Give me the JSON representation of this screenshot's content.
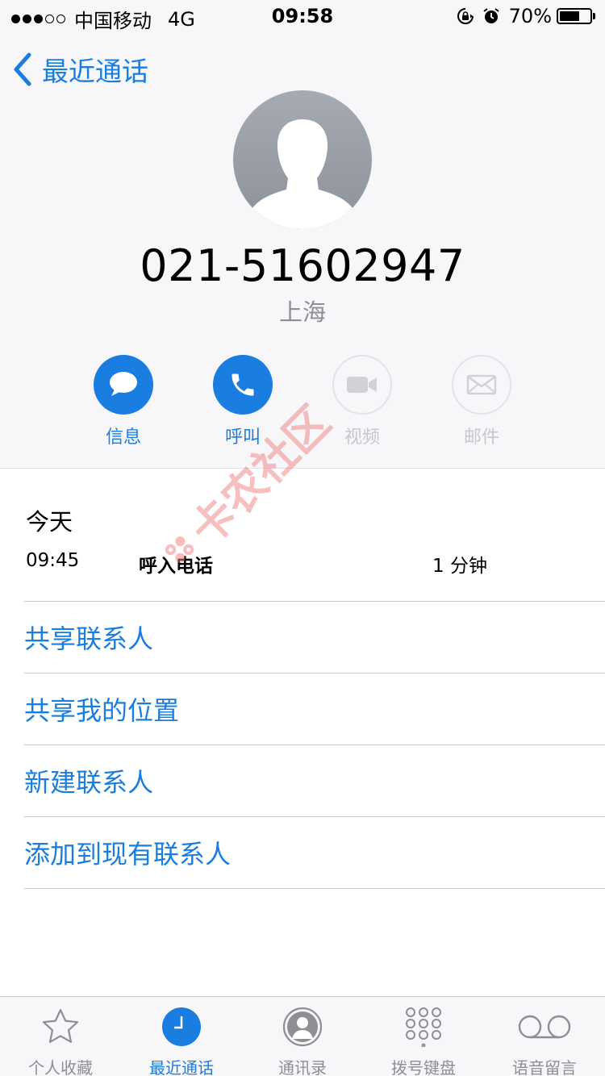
{
  "status_bar": {
    "carrier": "中国移动",
    "network": "4G",
    "time": "09:58",
    "battery_percent": "70%",
    "battery_level": 0.7,
    "signal_bars_filled": 3,
    "signal_bars_total": 5,
    "icons": [
      "orientation-lock-icon",
      "alarm-icon"
    ]
  },
  "nav": {
    "back_label": "最近通话"
  },
  "contact": {
    "phone_number": "021-51602947",
    "location": "上海"
  },
  "actions": [
    {
      "label": "信息",
      "icon": "message-icon",
      "enabled": true
    },
    {
      "label": "呼叫",
      "icon": "phone-icon",
      "enabled": true
    },
    {
      "label": "视频",
      "icon": "video-icon",
      "enabled": false
    },
    {
      "label": "邮件",
      "icon": "mail-icon",
      "enabled": false
    }
  ],
  "recents": {
    "day_label": "今天",
    "calls": [
      {
        "time": "09:45",
        "type": "呼入电话",
        "duration": "1 分钟"
      }
    ]
  },
  "options": [
    "共享联系人",
    "共享我的位置",
    "新建联系人",
    "添加到现有联系人"
  ],
  "watermark": {
    "text": "卡农社区",
    "icon": "kanong-logo-icon"
  },
  "tab_bar": {
    "active_index": 1,
    "tabs": [
      {
        "label": "个人收藏",
        "icon": "star-icon"
      },
      {
        "label": "最近通话",
        "icon": "clock-icon"
      },
      {
        "label": "通讯录",
        "icon": "contacts-icon"
      },
      {
        "label": "拨号键盘",
        "icon": "keypad-icon"
      },
      {
        "label": "语音留言",
        "icon": "voicemail-icon"
      }
    ]
  },
  "colors": {
    "accent": "#1a7de0",
    "disabled": "#c7c7cc",
    "secondary_text": "#8e8e93",
    "watermark": "#f08080"
  }
}
